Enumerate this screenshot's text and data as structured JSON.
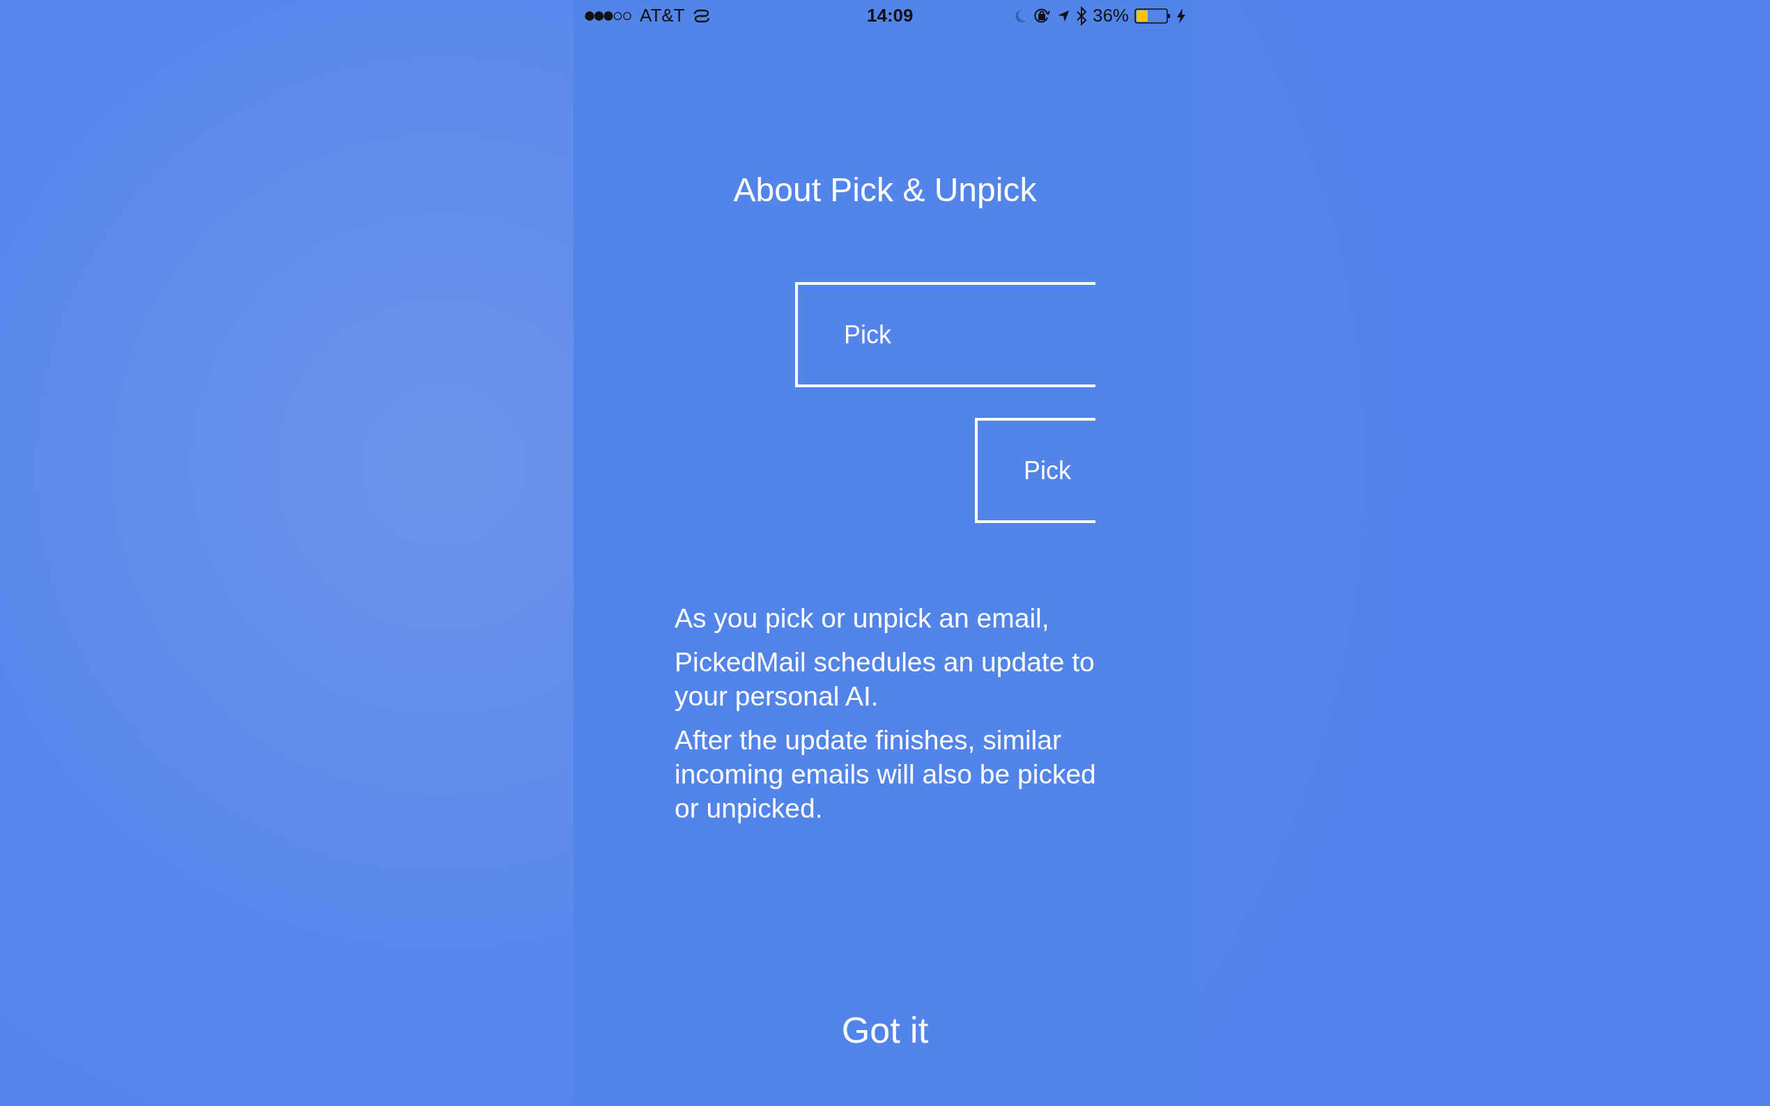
{
  "status_bar": {
    "carrier": "AT&T",
    "time": "14:09",
    "battery_percent": "36%"
  },
  "title": "About Pick & Unpick",
  "examples": [
    {
      "label": "Pick",
      "kind": "wide"
    },
    {
      "label": "Pick",
      "kind": "narrow"
    }
  ],
  "paragraphs": [
    "As you pick or unpick an email,",
    "PickedMail schedules an update to your personal AI.",
    "After the update finishes, similar incoming emails will also be picked or unpicked."
  ],
  "button": "Got it"
}
